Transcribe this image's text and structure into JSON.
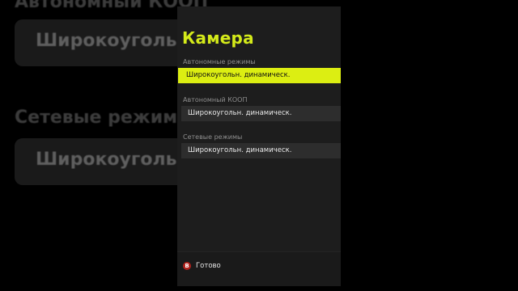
{
  "background": {
    "heading_top": "Автономный КООП",
    "field_top": "Широкоугольн",
    "heading_bottom": "Сетевые режимы",
    "field_bottom": "Широкоугольн"
  },
  "panel": {
    "title": "Камера",
    "sections": [
      {
        "label": "Автономные режимы",
        "value": "Широкоугольн. динамическ.",
        "selected": true
      },
      {
        "label": "Автономный КООП",
        "value": "Широкоугольн. динамическ.",
        "selected": false
      },
      {
        "label": "Сетевые режимы",
        "value": "Широкоугольн. динамическ.",
        "selected": false
      }
    ]
  },
  "footer": {
    "button_glyph": "B",
    "button_label": "Готово",
    "button_color": "#b1221c"
  },
  "colors": {
    "accent": "#dcee12",
    "title": "#d4ea1a"
  }
}
